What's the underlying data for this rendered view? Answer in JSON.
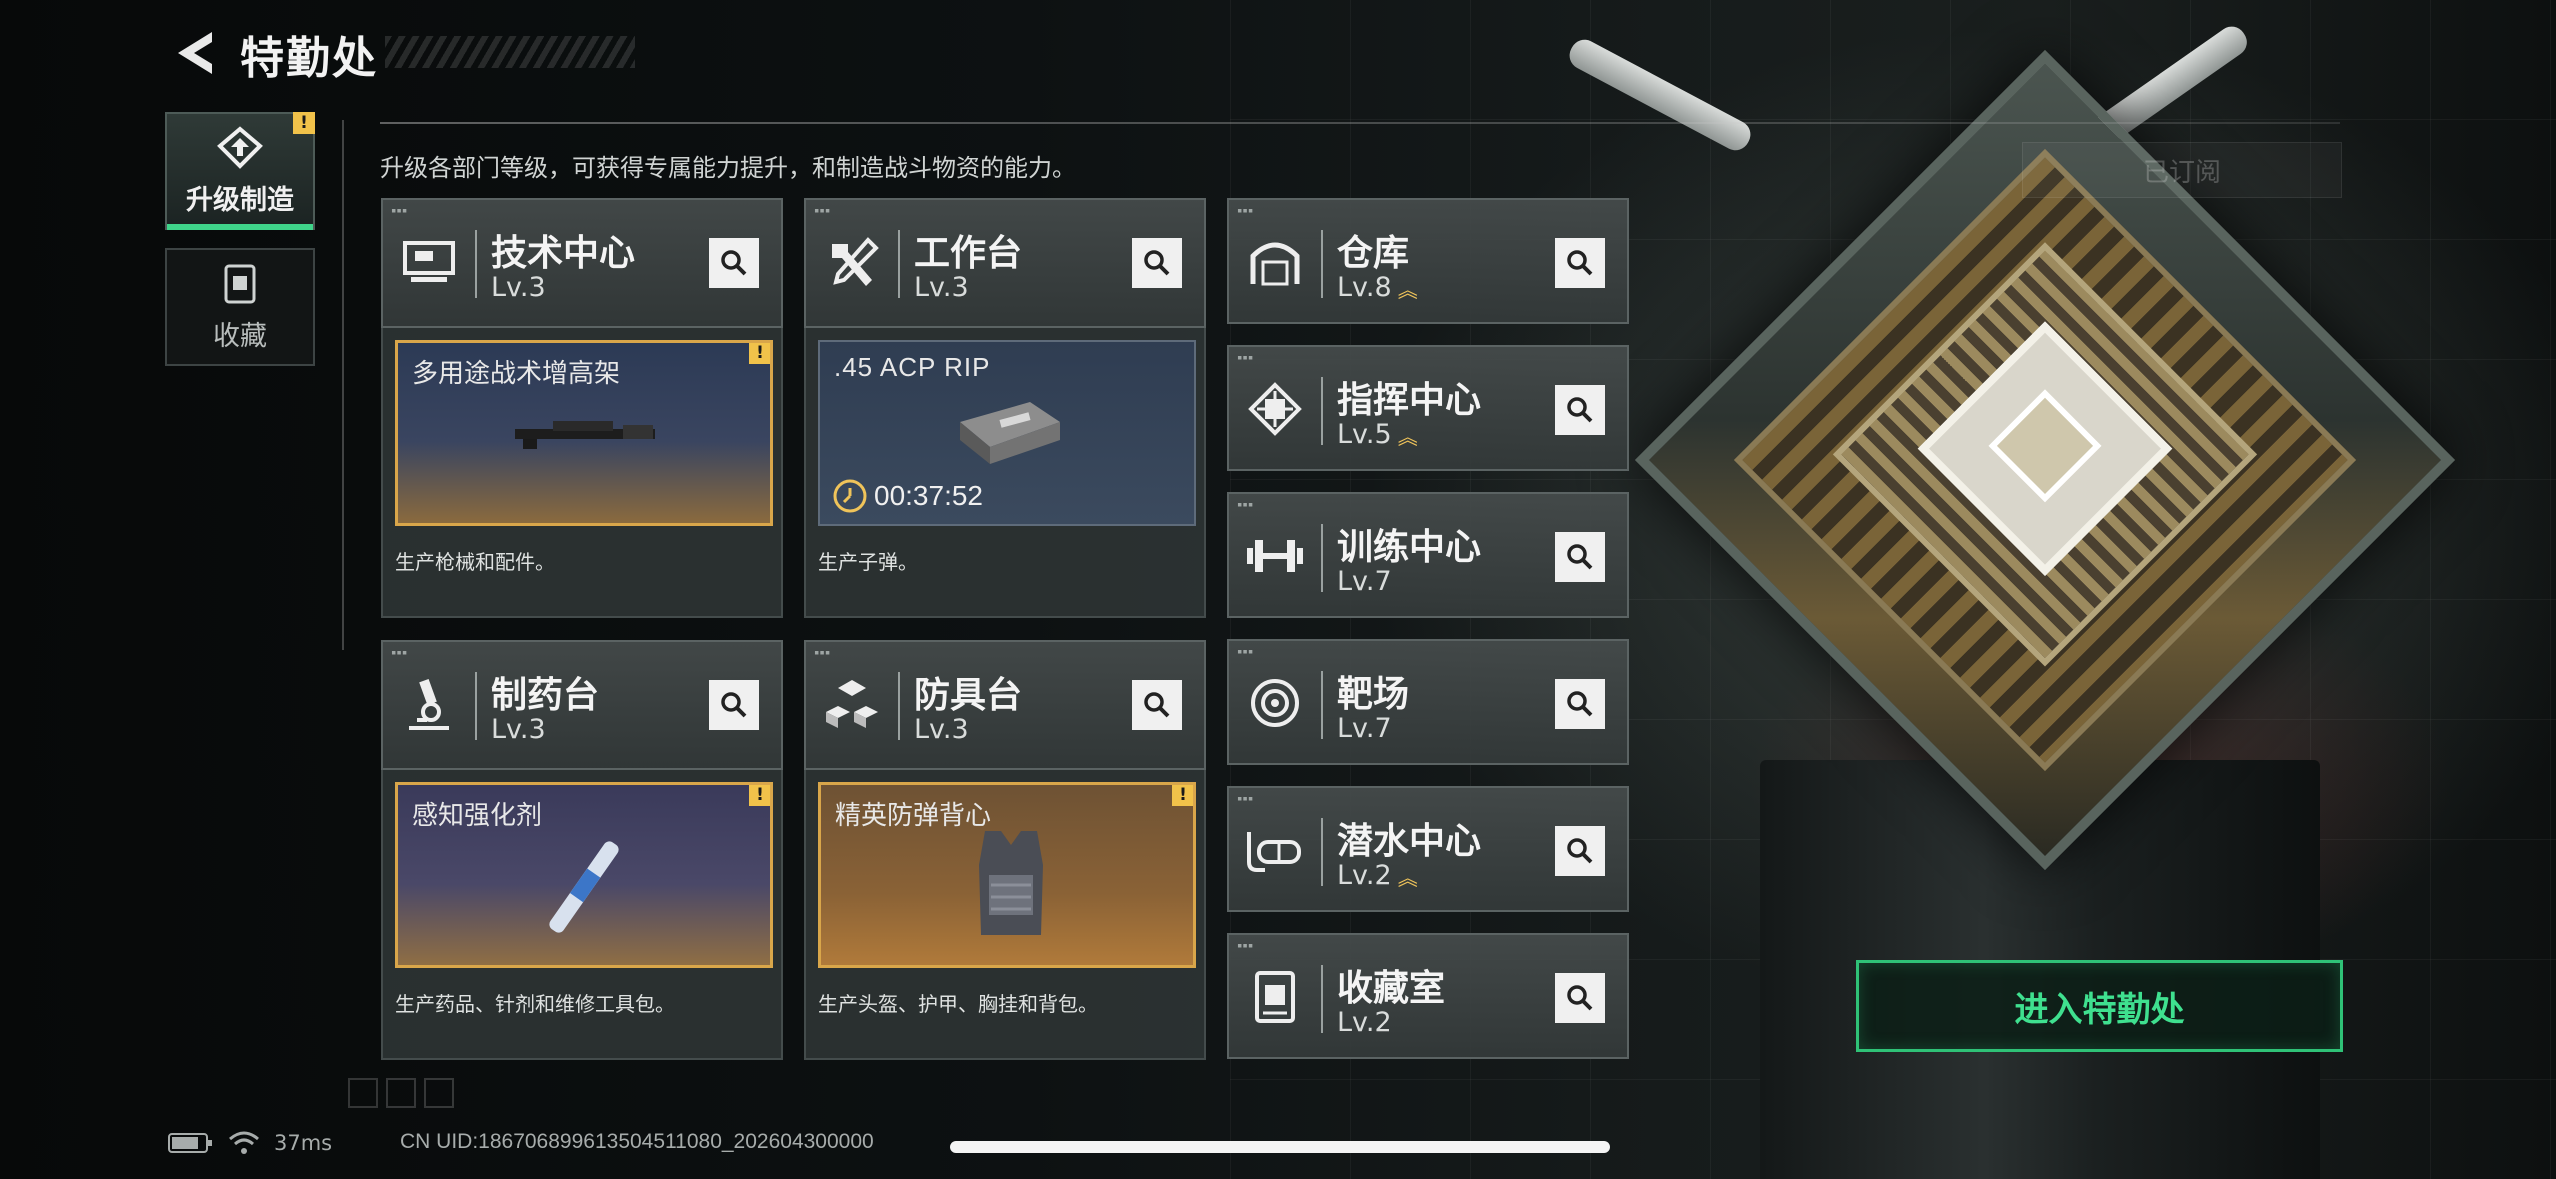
{
  "header": {
    "title": "特勤处"
  },
  "nav": [
    {
      "label": "升级制造",
      "icon": "upgrade-icon",
      "active": true,
      "alert": "!"
    },
    {
      "label": "收藏",
      "icon": "collection-icon",
      "active": false
    }
  ],
  "description": "升级各部门等级，可获得专属能力提升，和制造战斗物资的能力。",
  "workshops": [
    {
      "name": "技术中心",
      "level": "Lv.3",
      "icon": "tech-center-icon",
      "slot": {
        "item": "多用途战术增高架",
        "alert": "!"
      },
      "caption": "生产枪械和配件。"
    },
    {
      "name": "工作台",
      "level": "Lv.3",
      "icon": "workbench-icon",
      "slot": {
        "item": ".45 ACP RIP",
        "timer": "00:37:52"
      },
      "caption": "生产子弹。"
    },
    {
      "name": "制药台",
      "level": "Lv.3",
      "icon": "pharmacy-icon",
      "slot": {
        "item": "感知强化剂",
        "alert": "!"
      },
      "caption": "生产药品、针剂和维修工具包。"
    },
    {
      "name": "防具台",
      "level": "Lv.3",
      "icon": "armor-bench-icon",
      "slot": {
        "item": "精英防弹背心",
        "alert": "!"
      },
      "caption": "生产头盔、护甲、胸挂和背包。"
    }
  ],
  "facilities": [
    {
      "name": "仓库",
      "level": "Lv.8",
      "icon": "warehouse-icon",
      "upgradable": true
    },
    {
      "name": "指挥中心",
      "level": "Lv.5",
      "icon": "command-center-icon",
      "upgradable": true
    },
    {
      "name": "训练中心",
      "level": "Lv.7",
      "icon": "training-center-icon",
      "upgradable": false
    },
    {
      "name": "靶场",
      "level": "Lv.7",
      "icon": "target-range-icon",
      "upgradable": false
    },
    {
      "name": "潜水中心",
      "level": "Lv.2",
      "icon": "diving-center-icon",
      "upgradable": true
    },
    {
      "name": "收藏室",
      "level": "Lv.2",
      "icon": "collection-room-icon",
      "upgradable": false
    }
  ],
  "right": {
    "subscribed_label": "已订阅",
    "enter_button": "进入特勤处"
  },
  "status": {
    "ping": "37ms",
    "uid": "CN UID:186706899613504511080_202604300000"
  },
  "colors": {
    "accent": "#2fc277",
    "alert": "#f1c24a",
    "upgrade_arrow": "#f0c45a"
  }
}
